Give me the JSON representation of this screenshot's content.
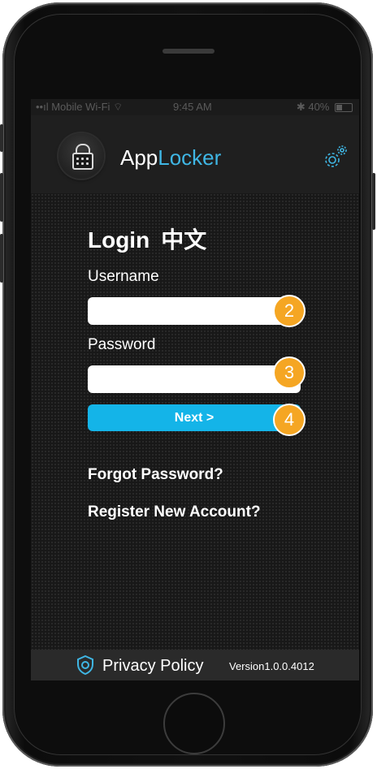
{
  "status_bar": {
    "carrier": "Mobile Wi-Fi",
    "time": "9:45 AM",
    "battery": "40%"
  },
  "header": {
    "app_name_prefix": "App",
    "app_name_accent": "Locker",
    "settings_icon": "gear-icon"
  },
  "login": {
    "title": "Login",
    "language": "中文",
    "username_label": "Username",
    "username_value": "",
    "password_label": "Password",
    "password_value": "",
    "next_label": "Next >",
    "forgot_password": "Forgot Password?",
    "register": "Register New Account?"
  },
  "callouts": [
    "2",
    "3",
    "4"
  ],
  "footer": {
    "privacy": "Privacy Policy",
    "version": "Version1.0.0.4012"
  },
  "colors": {
    "accent": "#3fb6e4",
    "button": "#14b4e8",
    "callout": "#f5a623"
  }
}
